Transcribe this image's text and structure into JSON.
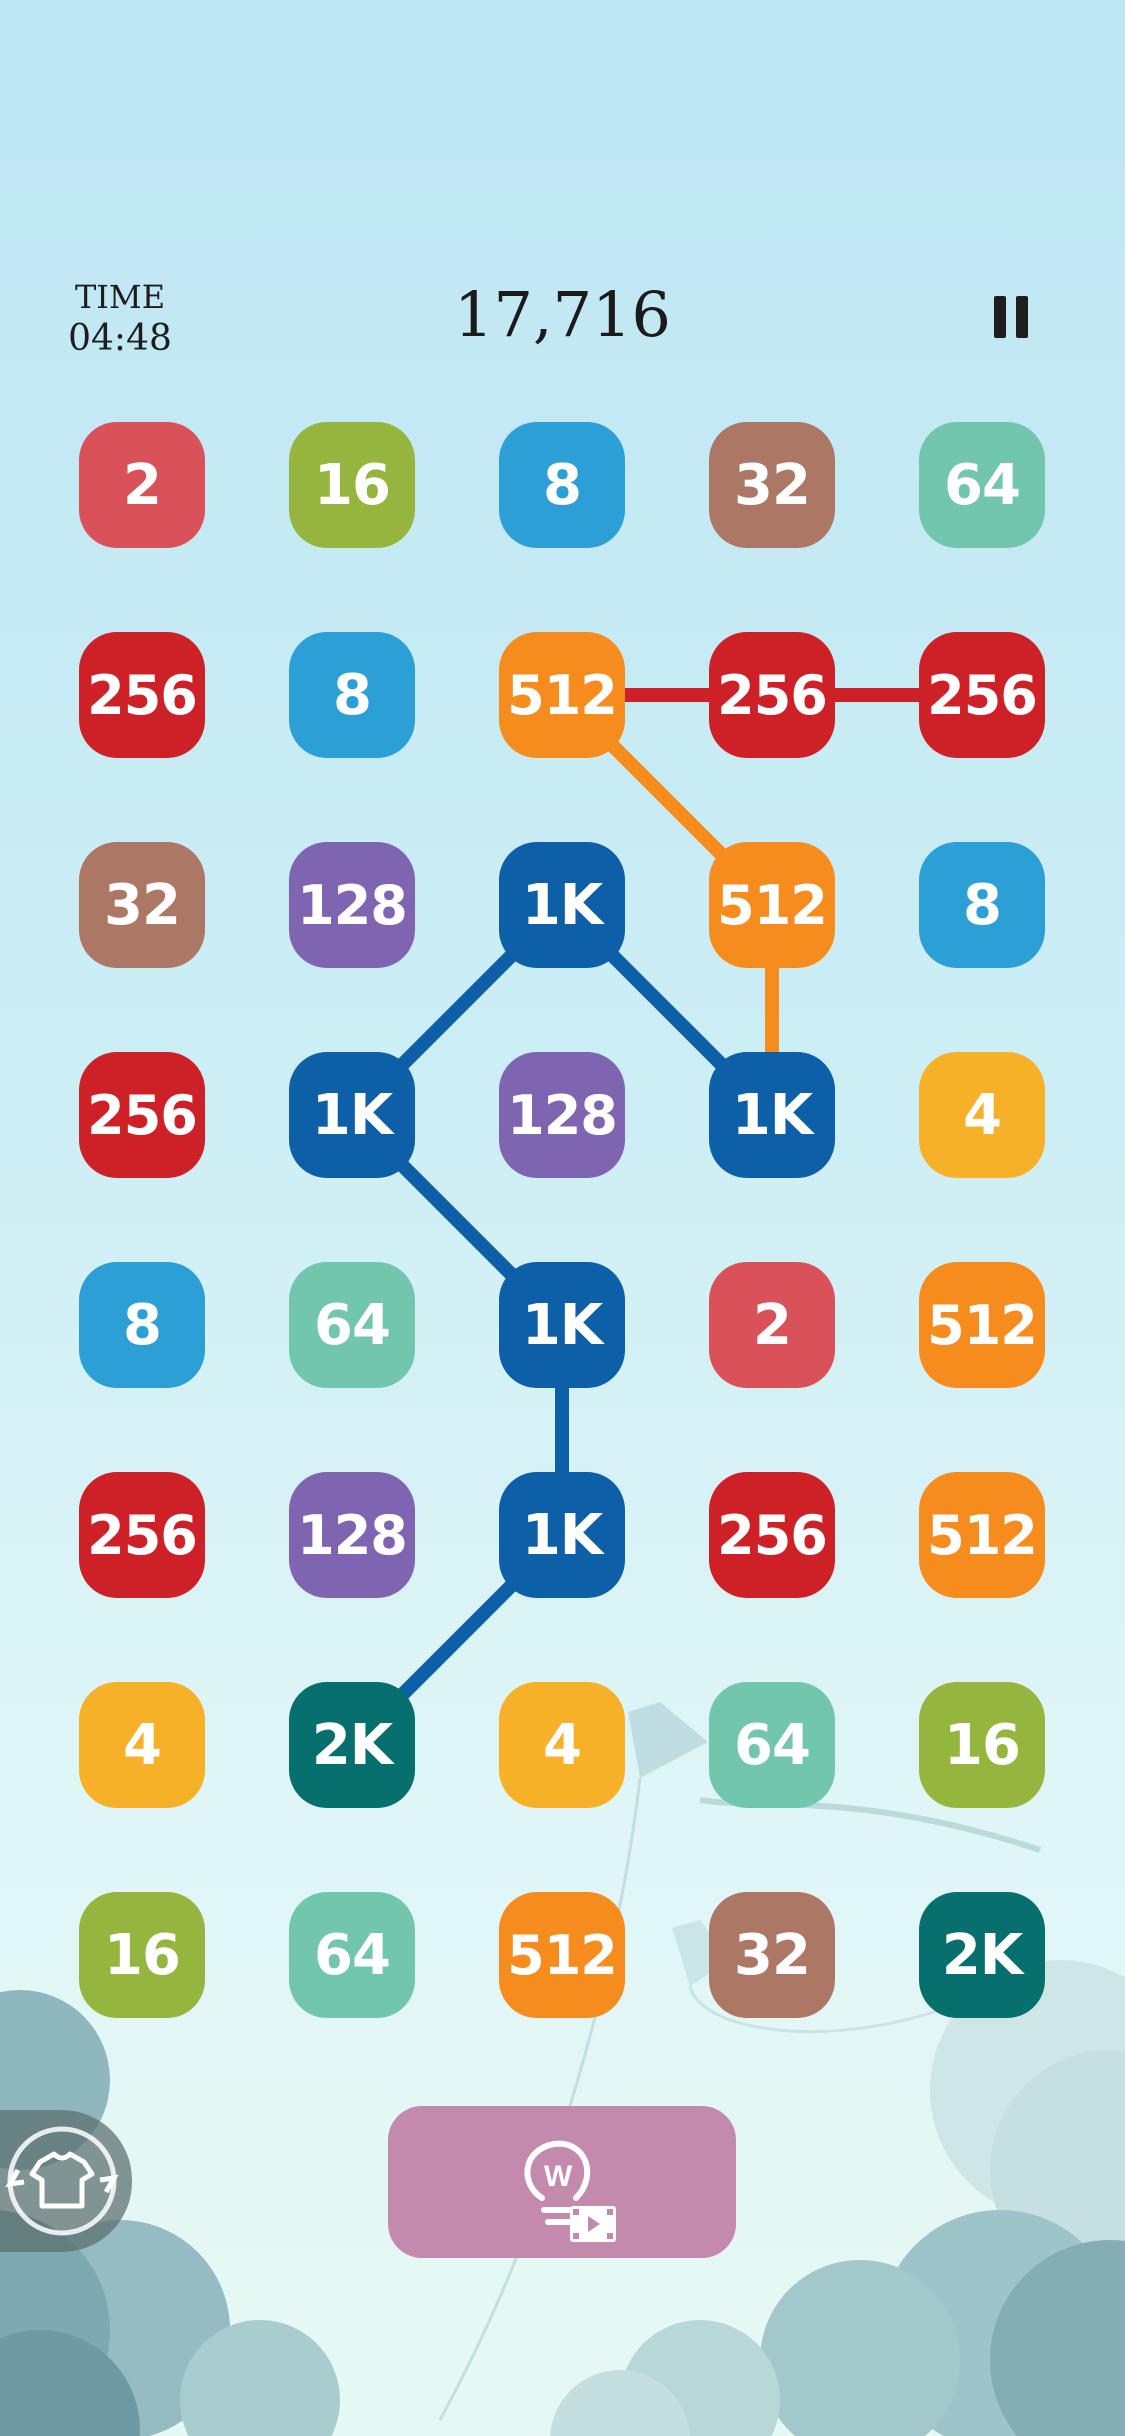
{
  "hud": {
    "time_label": "TIME",
    "time_value": "04:48",
    "score": "17,716",
    "pause_icon": "pause-icon"
  },
  "colors": {
    "2": "#d9525a",
    "4": "#f6b128",
    "8": "#2c9fd6",
    "16": "#96b53e",
    "32": "#ad7766",
    "64": "#72c6ae",
    "128": "#7f64b2",
    "256": "#cd2027",
    "512": "#f68c1e",
    "1K": "#0d5fa8",
    "2K": "#076f6d"
  },
  "board": {
    "rows": [
      [
        "2",
        "16",
        "8",
        "32",
        "64"
      ],
      [
        "256",
        "8",
        "512",
        "256",
        "256"
      ],
      [
        "32",
        "128",
        "1K",
        "512",
        "8"
      ],
      [
        "256",
        "1K",
        "128",
        "1K",
        "4"
      ],
      [
        "8",
        "64",
        "1K",
        "2",
        "512"
      ],
      [
        "256",
        "128",
        "1K",
        "256",
        "512"
      ],
      [
        "4",
        "2K",
        "4",
        "64",
        "16"
      ],
      [
        "16",
        "64",
        "512",
        "32",
        "2K"
      ]
    ]
  },
  "chains": [
    {
      "value": "256",
      "color": "#cd2027",
      "cells": [
        [
          1,
          2
        ],
        [
          1,
          3
        ],
        [
          1,
          4
        ]
      ]
    },
    {
      "value": "512",
      "color": "#f68c1e",
      "cells": [
        [
          1,
          2
        ],
        [
          2,
          3
        ],
        [
          3,
          3
        ]
      ]
    },
    {
      "value": "1K",
      "color": "#0d5fa8",
      "cells": [
        [
          3,
          3
        ],
        [
          2,
          2
        ],
        [
          3,
          1
        ],
        [
          4,
          2
        ],
        [
          5,
          2
        ],
        [
          6,
          1
        ]
      ]
    }
  ],
  "controls": {
    "hint_icon": "hint-video-icon",
    "hint_letter": "W",
    "skin_icon": "theme-shirt-icon"
  }
}
